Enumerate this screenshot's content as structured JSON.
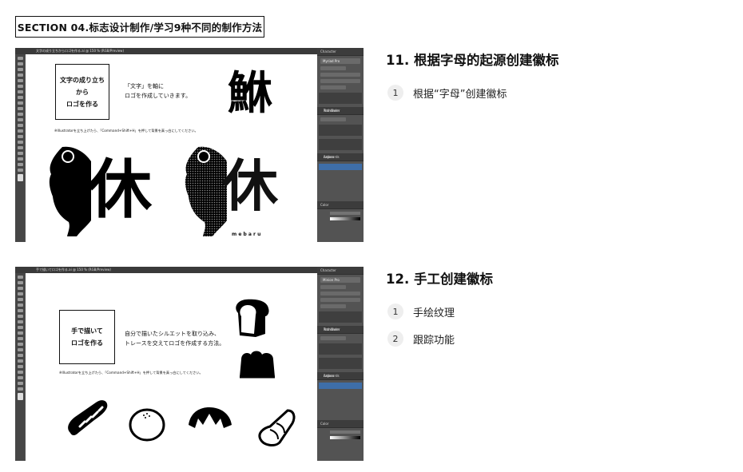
{
  "section_title": "SECTION 04.标志设计制作/学习9种不同的制作方法",
  "screenshot1": {
    "window_title": "文字の成り立ちからロゴを作る.ai @ 150 % (RGB/Preview)",
    "logo_text": "文字の成り立ち\nから\nロゴを作る",
    "caption": "「文字」を軸に\nロゴを作成していきます。",
    "note": "※Illustratorを立ち上げたら、「Command+Shift+H」を押して背景を真っ白にしてください。",
    "kanji": "鮴",
    "kanji_part": "休",
    "sub_text": "m e b a r u",
    "panel_character": "Character",
    "panel_font": "Myriad Pro",
    "panel_transform": "Transform",
    "panel_pathfinder": "Pathfinder",
    "panel_layers": "Layers",
    "panel_artboards": "Artboards",
    "panel_color": "Color"
  },
  "screenshot2": {
    "window_title": "手で描いてロゴを作る.ai @ 150 % (RGB/Preview)",
    "logo_text": "手で描いて\nロゴを作る",
    "caption": "自分で描いたシルエットを取り込み、\nトレースを交えてロゴを作成する方法。",
    "note": "※Illustratorを立ち上げたら、「Command+Shift+H」を押して背景を真っ白にしてください。",
    "panel_character": "Character",
    "panel_font": "Minion Pro",
    "panel_transform": "Transform",
    "panel_pathfinder": "Pathfinder",
    "panel_layers": "Layers",
    "panel_artboards": "Artboards",
    "panel_color": "Color"
  },
  "block1": {
    "heading": "11. 根据字母的起源创建徽标",
    "items": [
      {
        "num": "1",
        "text": "根据“字母”创建徽标"
      }
    ]
  },
  "block2": {
    "heading": "12. 手工创建徽标",
    "items": [
      {
        "num": "1",
        "text": "手绘纹理"
      },
      {
        "num": "2",
        "text": "跟踪功能"
      }
    ]
  }
}
